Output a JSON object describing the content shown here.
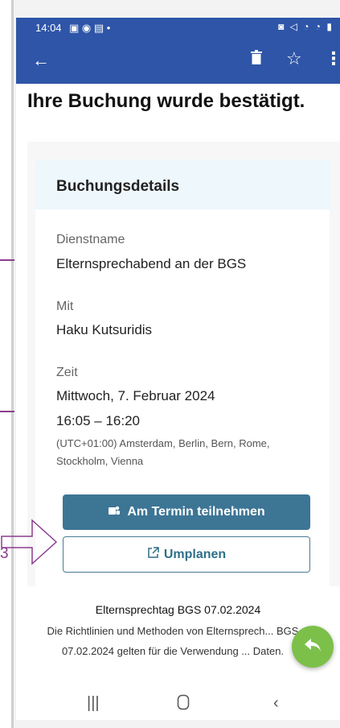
{
  "status_bar": {
    "time": "14:04",
    "left_icons": "▣ ◉ ▤ •",
    "right_icons": "◙ ◁ ◔ ◔ ▮"
  },
  "app_bar": {
    "back_icon": "arrow-left-icon",
    "delete_icon": "trash-icon",
    "star_icon": "star-icon",
    "more_icon": "more-vertical-icon"
  },
  "headline": "Ihre Buchung wurde bestätigt.",
  "booking": {
    "title": "Buchungsdetails",
    "service_label": "Dienstname",
    "service_value": "Elternsprechabend an der BGS",
    "with_label": "Mit",
    "with_value": "Haku Kutsuridis",
    "time_label": "Zeit",
    "date_value": "Mittwoch, 7. Februar 2024",
    "time_value": "16:05 – 16:20",
    "timezone_value": "(UTC+01:00) Amsterdam, Berlin, Bern, Rome, Stockholm, Vienna",
    "join_button": "Am Termin teilnehmen",
    "reschedule_button": "Umplanen"
  },
  "footer": {
    "title": "Elternsprechtag BGS 07.02.2024",
    "text": "Die Richtlinien und Methoden von Elternsprech... BGS 07.02.2024 gelten für die Verwendung ... Daten."
  },
  "annotation": {
    "number": "3",
    "color": "#8b3d8f"
  },
  "colors": {
    "appbar": "#2e55a7",
    "primary_button": "#3d7595",
    "fab": "#7cc04a"
  }
}
